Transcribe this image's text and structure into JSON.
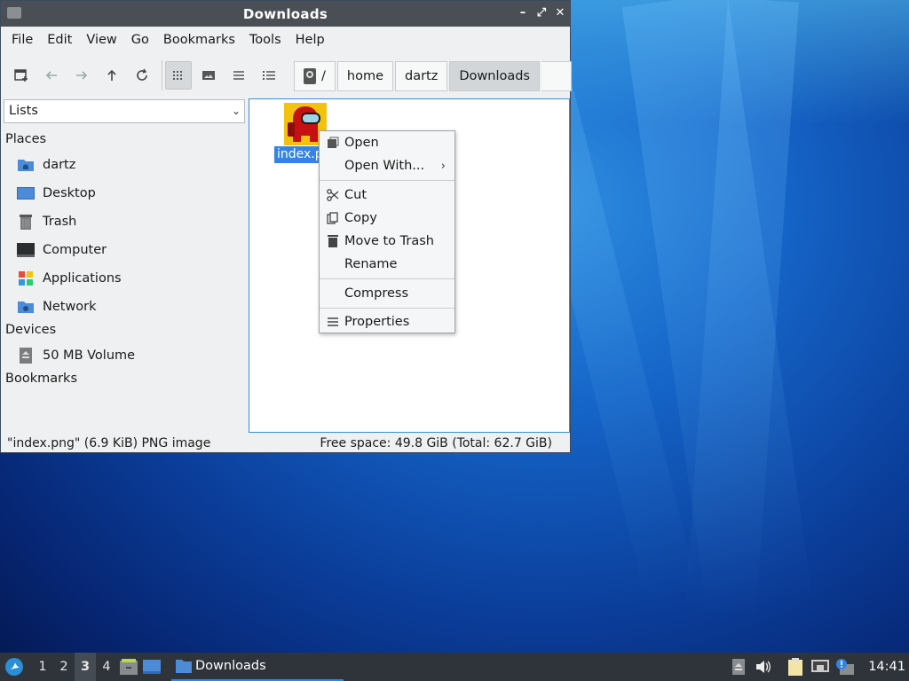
{
  "window": {
    "title": "Downloads"
  },
  "menubar": [
    "File",
    "Edit",
    "View",
    "Go",
    "Bookmarks",
    "Tools",
    "Help"
  ],
  "path": [
    "/",
    "home",
    "dartz",
    "Downloads"
  ],
  "sidebar": {
    "combo": "Lists",
    "places_heading": "Places",
    "places": [
      {
        "label": "dartz",
        "icon": "home-folder-icon"
      },
      {
        "label": "Desktop",
        "icon": "desktop-icon"
      },
      {
        "label": "Trash",
        "icon": "trash-icon"
      },
      {
        "label": "Computer",
        "icon": "computer-icon"
      },
      {
        "label": "Applications",
        "icon": "applications-icon"
      },
      {
        "label": "Network",
        "icon": "network-icon"
      }
    ],
    "devices_heading": "Devices",
    "devices": [
      {
        "label": "50 MB Volume",
        "icon": "drive-icon"
      }
    ],
    "bookmarks_heading": "Bookmarks"
  },
  "files": [
    {
      "name": "index.png",
      "label_visible": "index.p"
    }
  ],
  "context_menu": {
    "open": "Open",
    "open_with": "Open With...",
    "cut": "Cut",
    "copy": "Copy",
    "move_to_trash": "Move to Trash",
    "rename": "Rename",
    "compress": "Compress",
    "properties": "Properties"
  },
  "status": {
    "left": "\"index.png\" (6.9 KiB) PNG image",
    "right": "Free space: 49.8 GiB (Total: 62.7 GiB)"
  },
  "taskbar": {
    "workspaces": [
      "1",
      "2",
      "3",
      "4"
    ],
    "active_workspace": "3",
    "task": "Downloads",
    "clock": "14:41"
  },
  "colors": {
    "selection": "#3584e4",
    "titlebar": "#4a4f55",
    "taskbar": "#2f343a"
  }
}
